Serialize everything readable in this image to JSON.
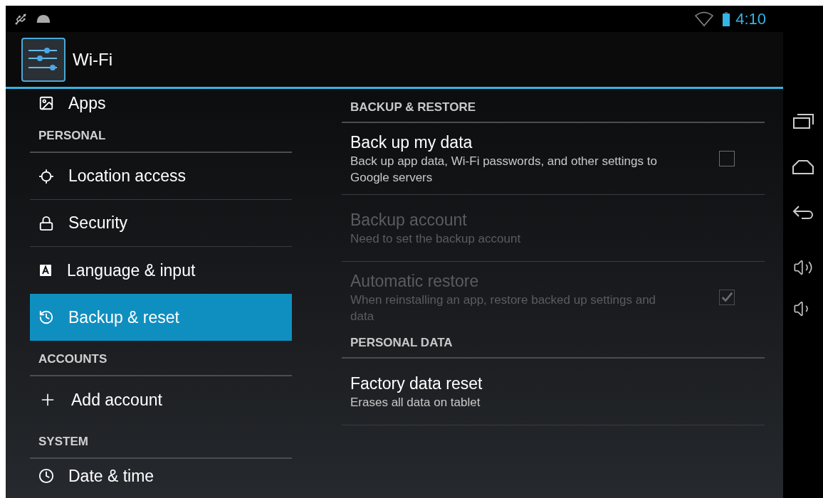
{
  "status_bar": {
    "time": "4:10"
  },
  "action_bar": {
    "title": "Wi-Fi"
  },
  "sidebar": {
    "items": [
      {
        "kind": "item",
        "label": "Apps",
        "selected": false
      },
      {
        "kind": "header",
        "label": "PERSONAL"
      },
      {
        "kind": "item",
        "label": "Location access",
        "selected": false
      },
      {
        "kind": "item",
        "label": "Security",
        "selected": false
      },
      {
        "kind": "item",
        "label": "Language & input",
        "selected": false
      },
      {
        "kind": "item",
        "label": "Backup & reset",
        "selected": true
      },
      {
        "kind": "header",
        "label": "ACCOUNTS"
      },
      {
        "kind": "item",
        "label": "Add account",
        "selected": false
      },
      {
        "kind": "header",
        "label": "SYSTEM"
      },
      {
        "kind": "item",
        "label": "Date & time",
        "selected": false
      }
    ]
  },
  "detail": {
    "sections": [
      {
        "header": "BACKUP & RESTORE",
        "items": [
          {
            "kind": "checkbox",
            "title": "Back up my data",
            "summary": "Back up app data, Wi-Fi passwords, and other settings to Google servers",
            "checked": false,
            "disabled": false
          },
          {
            "kind": "plain",
            "title": "Backup account",
            "summary": "Need to set the backup account",
            "disabled": true
          },
          {
            "kind": "checkbox",
            "title": "Automatic restore",
            "summary": "When reinstalling an app, restore backed up settings and data",
            "checked": true,
            "disabled": true
          }
        ]
      },
      {
        "header": "PERSONAL DATA",
        "items": [
          {
            "kind": "plain",
            "title": "Factory data reset",
            "summary": "Erases all data on tablet",
            "disabled": false
          }
        ]
      }
    ]
  }
}
